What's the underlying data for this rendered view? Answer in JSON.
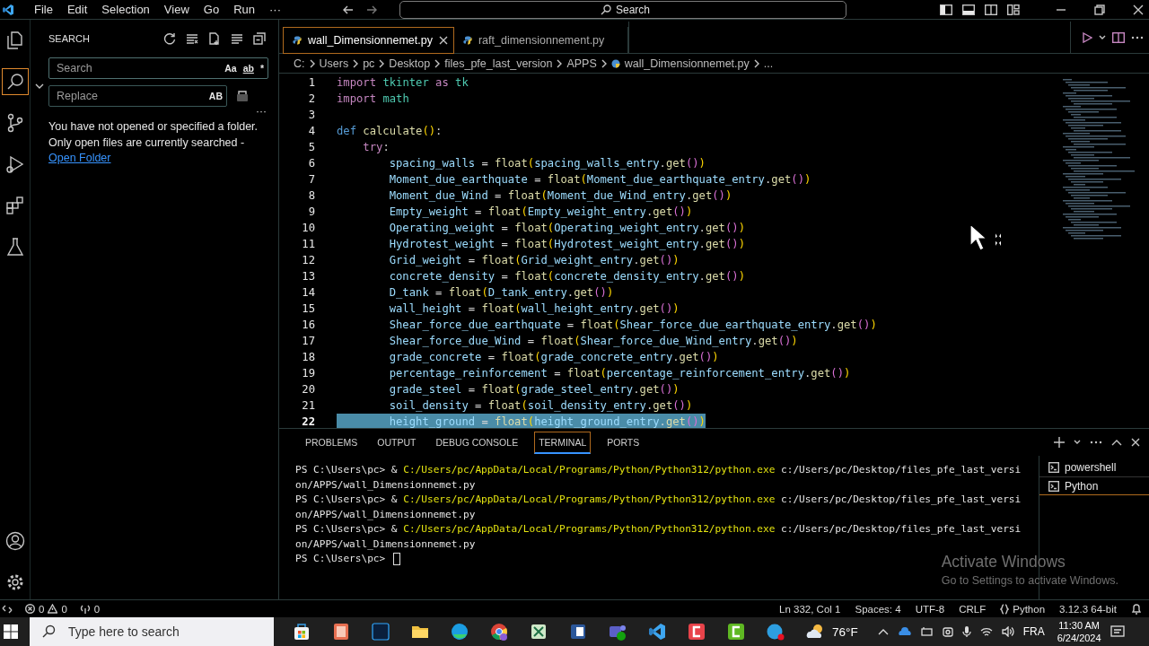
{
  "title_bar": {
    "menu": [
      "File",
      "Edit",
      "Selection",
      "View",
      "Go",
      "Run",
      "···"
    ],
    "command_center": {
      "placeholder": "Search"
    }
  },
  "sidebar": {
    "title": "SEARCH",
    "search": {
      "placeholder": "Search"
    },
    "search_options": [
      "Aa",
      "ab",
      "*"
    ],
    "replace": {
      "placeholder": "Replace"
    },
    "replace_option": "AB",
    "more": "···",
    "message": "You have not opened or specified a folder. Only open files are currently searched - ",
    "link": "Open Folder"
  },
  "tabs": [
    {
      "label": "wall_Dimensionnemet.py",
      "selected": true
    },
    {
      "label": "raft_dimensionnement.py",
      "selected": false
    }
  ],
  "breadcrumbs": [
    "C:",
    "Users",
    "pc",
    "Desktop",
    "files_pfe_last_version",
    "APPS",
    "wall_Dimensionnemet.py",
    "..."
  ],
  "code_lines": [
    {
      "number": "1",
      "selected": false,
      "tokens": [
        {
          "kind": "kw",
          "text": "import "
        },
        {
          "kind": "mod",
          "text": "tkinter "
        },
        {
          "kind": "kw",
          "text": "as "
        },
        {
          "kind": "mod",
          "text": "tk"
        }
      ]
    },
    {
      "number": "2",
      "selected": false,
      "tokens": [
        {
          "kind": "kw",
          "text": "import "
        },
        {
          "kind": "mod",
          "text": "math"
        }
      ]
    },
    {
      "number": "3",
      "selected": false
    },
    {
      "number": "4",
      "selected": false,
      "tokens": [
        {
          "kind": "def",
          "text": "def "
        },
        {
          "kind": "fn",
          "text": "calculate"
        },
        {
          "kind": "p1",
          "text": "()"
        },
        {
          "kind": "op",
          "text": ":"
        }
      ]
    },
    {
      "number": "5",
      "selected": false,
      "tokens": [
        {
          "kind": "kw",
          "text": "    try"
        },
        {
          "kind": "op",
          "text": ":"
        }
      ]
    },
    {
      "number": "6",
      "selected": false,
      "tokens": [
        {
          "kind": "var",
          "text": "        spacing_walls"
        },
        {
          "kind": "op",
          "text": " = "
        },
        {
          "kind": "fn",
          "text": "float"
        },
        {
          "kind": "p1",
          "text": "("
        },
        {
          "kind": "var",
          "text": "spacing_walls_entry"
        },
        {
          "kind": "op",
          "text": "."
        },
        {
          "kind": "fn",
          "text": "get"
        },
        {
          "kind": "p2",
          "text": "()"
        },
        {
          "kind": "p1",
          "text": ")"
        }
      ]
    },
    {
      "number": "7",
      "selected": false,
      "tokens": [
        {
          "kind": "var",
          "text": "        Moment_due_earthquate"
        },
        {
          "kind": "op",
          "text": " = "
        },
        {
          "kind": "fn",
          "text": "float"
        },
        {
          "kind": "p1",
          "text": "("
        },
        {
          "kind": "var",
          "text": "Moment_due_earthquate_entry"
        },
        {
          "kind": "op",
          "text": "."
        },
        {
          "kind": "fn",
          "text": "get"
        },
        {
          "kind": "p2",
          "text": "()"
        },
        {
          "kind": "p1",
          "text": ")"
        }
      ]
    },
    {
      "number": "8",
      "selected": false,
      "tokens": [
        {
          "kind": "var",
          "text": "        Moment_due_Wind"
        },
        {
          "kind": "op",
          "text": " = "
        },
        {
          "kind": "fn",
          "text": "float"
        },
        {
          "kind": "p1",
          "text": "("
        },
        {
          "kind": "var",
          "text": "Moment_due_Wind_entry"
        },
        {
          "kind": "op",
          "text": "."
        },
        {
          "kind": "fn",
          "text": "get"
        },
        {
          "kind": "p2",
          "text": "()"
        },
        {
          "kind": "p1",
          "text": ")"
        }
      ]
    },
    {
      "number": "9",
      "selected": false,
      "tokens": [
        {
          "kind": "var",
          "text": "        Empty_weight"
        },
        {
          "kind": "op",
          "text": " = "
        },
        {
          "kind": "fn",
          "text": "float"
        },
        {
          "kind": "p1",
          "text": "("
        },
        {
          "kind": "var",
          "text": "Empty_weight_entry"
        },
        {
          "kind": "op",
          "text": "."
        },
        {
          "kind": "fn",
          "text": "get"
        },
        {
          "kind": "p2",
          "text": "()"
        },
        {
          "kind": "p1",
          "text": ")"
        }
      ]
    },
    {
      "number": "10",
      "selected": false,
      "tokens": [
        {
          "kind": "var",
          "text": "        Operating_weight"
        },
        {
          "kind": "op",
          "text": " = "
        },
        {
          "kind": "fn",
          "text": "float"
        },
        {
          "kind": "p1",
          "text": "("
        },
        {
          "kind": "var",
          "text": "Operating_weight_entry"
        },
        {
          "kind": "op",
          "text": "."
        },
        {
          "kind": "fn",
          "text": "get"
        },
        {
          "kind": "p2",
          "text": "()"
        },
        {
          "kind": "p1",
          "text": ")"
        }
      ]
    },
    {
      "number": "11",
      "selected": false,
      "tokens": [
        {
          "kind": "var",
          "text": "        Hydrotest_weight"
        },
        {
          "kind": "op",
          "text": " = "
        },
        {
          "kind": "fn",
          "text": "float"
        },
        {
          "kind": "p1",
          "text": "("
        },
        {
          "kind": "var",
          "text": "Hydrotest_weight_entry"
        },
        {
          "kind": "op",
          "text": "."
        },
        {
          "kind": "fn",
          "text": "get"
        },
        {
          "kind": "p2",
          "text": "()"
        },
        {
          "kind": "p1",
          "text": ")"
        }
      ]
    },
    {
      "number": "12",
      "selected": false,
      "tokens": [
        {
          "kind": "var",
          "text": "        Grid_weight"
        },
        {
          "kind": "op",
          "text": " = "
        },
        {
          "kind": "fn",
          "text": "float"
        },
        {
          "kind": "p1",
          "text": "("
        },
        {
          "kind": "var",
          "text": "Grid_weight_entry"
        },
        {
          "kind": "op",
          "text": "."
        },
        {
          "kind": "fn",
          "text": "get"
        },
        {
          "kind": "p2",
          "text": "()"
        },
        {
          "kind": "p1",
          "text": ")"
        }
      ]
    },
    {
      "number": "13",
      "selected": false,
      "tokens": [
        {
          "kind": "var",
          "text": "        concrete_density"
        },
        {
          "kind": "op",
          "text": " = "
        },
        {
          "kind": "fn",
          "text": "float"
        },
        {
          "kind": "p1",
          "text": "("
        },
        {
          "kind": "var",
          "text": "concrete_density_entry"
        },
        {
          "kind": "op",
          "text": "."
        },
        {
          "kind": "fn",
          "text": "get"
        },
        {
          "kind": "p2",
          "text": "()"
        },
        {
          "kind": "p1",
          "text": ")"
        }
      ]
    },
    {
      "number": "14",
      "selected": false,
      "tokens": [
        {
          "kind": "var",
          "text": "        D_tank"
        },
        {
          "kind": "op",
          "text": " = "
        },
        {
          "kind": "fn",
          "text": "float"
        },
        {
          "kind": "p1",
          "text": "("
        },
        {
          "kind": "var",
          "text": "D_tank_entry"
        },
        {
          "kind": "op",
          "text": "."
        },
        {
          "kind": "fn",
          "text": "get"
        },
        {
          "kind": "p2",
          "text": "()"
        },
        {
          "kind": "p1",
          "text": ")"
        }
      ]
    },
    {
      "number": "15",
      "selected": false,
      "tokens": [
        {
          "kind": "var",
          "text": "        wall_height"
        },
        {
          "kind": "op",
          "text": " = "
        },
        {
          "kind": "fn",
          "text": "float"
        },
        {
          "kind": "p1",
          "text": "("
        },
        {
          "kind": "var",
          "text": "wall_height_entry"
        },
        {
          "kind": "op",
          "text": "."
        },
        {
          "kind": "fn",
          "text": "get"
        },
        {
          "kind": "p2",
          "text": "()"
        },
        {
          "kind": "p1",
          "text": ")"
        }
      ]
    },
    {
      "number": "16",
      "selected": false,
      "tokens": [
        {
          "kind": "var",
          "text": "        Shear_force_due_earthquate"
        },
        {
          "kind": "op",
          "text": " = "
        },
        {
          "kind": "fn",
          "text": "float"
        },
        {
          "kind": "p1",
          "text": "("
        },
        {
          "kind": "var",
          "text": "Shear_force_due_earthquate_entry"
        },
        {
          "kind": "op",
          "text": "."
        },
        {
          "kind": "fn",
          "text": "get"
        },
        {
          "kind": "p2",
          "text": "()"
        },
        {
          "kind": "p1",
          "text": ")"
        }
      ]
    },
    {
      "number": "17",
      "selected": false,
      "tokens": [
        {
          "kind": "var",
          "text": "        Shear_force_due_Wind"
        },
        {
          "kind": "op",
          "text": " = "
        },
        {
          "kind": "fn",
          "text": "float"
        },
        {
          "kind": "p1",
          "text": "("
        },
        {
          "kind": "var",
          "text": "Shear_force_due_Wind_entry"
        },
        {
          "kind": "op",
          "text": "."
        },
        {
          "kind": "fn",
          "text": "get"
        },
        {
          "kind": "p2",
          "text": "()"
        },
        {
          "kind": "p1",
          "text": ")"
        }
      ]
    },
    {
      "number": "18",
      "selected": false,
      "tokens": [
        {
          "kind": "var",
          "text": "        grade_concrete"
        },
        {
          "kind": "op",
          "text": " = "
        },
        {
          "kind": "fn",
          "text": "float"
        },
        {
          "kind": "p1",
          "text": "("
        },
        {
          "kind": "var",
          "text": "grade_concrete_entry"
        },
        {
          "kind": "op",
          "text": "."
        },
        {
          "kind": "fn",
          "text": "get"
        },
        {
          "kind": "p2",
          "text": "()"
        },
        {
          "kind": "p1",
          "text": ")"
        }
      ]
    },
    {
      "number": "19",
      "selected": false,
      "tokens": [
        {
          "kind": "var",
          "text": "        percentage_reinforcement"
        },
        {
          "kind": "op",
          "text": " = "
        },
        {
          "kind": "fn",
          "text": "float"
        },
        {
          "kind": "p1",
          "text": "("
        },
        {
          "kind": "var",
          "text": "percentage_reinforcement_entry"
        },
        {
          "kind": "op",
          "text": "."
        },
        {
          "kind": "fn",
          "text": "get"
        },
        {
          "kind": "p2",
          "text": "()"
        },
        {
          "kind": "p1",
          "text": ")"
        }
      ]
    },
    {
      "number": "20",
      "selected": false,
      "tokens": [
        {
          "kind": "var",
          "text": "        grade_steel"
        },
        {
          "kind": "op",
          "text": " = "
        },
        {
          "kind": "fn",
          "text": "float"
        },
        {
          "kind": "p1",
          "text": "("
        },
        {
          "kind": "var",
          "text": "grade_steel_entry"
        },
        {
          "kind": "op",
          "text": "."
        },
        {
          "kind": "fn",
          "text": "get"
        },
        {
          "kind": "p2",
          "text": "()"
        },
        {
          "kind": "p1",
          "text": ")"
        }
      ]
    },
    {
      "number": "21",
      "selected": false,
      "tokens": [
        {
          "kind": "var",
          "text": "        soil_density"
        },
        {
          "kind": "op",
          "text": " = "
        },
        {
          "kind": "fn",
          "text": "float"
        },
        {
          "kind": "p1",
          "text": "("
        },
        {
          "kind": "var",
          "text": "soil_density_entry"
        },
        {
          "kind": "op",
          "text": "."
        },
        {
          "kind": "fn",
          "text": "get"
        },
        {
          "kind": "p2",
          "text": "()"
        },
        {
          "kind": "p1",
          "text": ")"
        }
      ]
    },
    {
      "number": "22",
      "selected": true,
      "tokens": [
        {
          "kind": "var",
          "text": "        height_ground"
        },
        {
          "kind": "op",
          "text": " = "
        },
        {
          "kind": "fn",
          "text": "float"
        },
        {
          "kind": "p1",
          "text": "("
        },
        {
          "kind": "var",
          "text": "height_ground_entry"
        },
        {
          "kind": "op",
          "text": "."
        },
        {
          "kind": "fn",
          "text": "get"
        },
        {
          "kind": "p2",
          "text": "()"
        },
        {
          "kind": "p1",
          "text": ")"
        }
      ]
    }
  ],
  "panel": {
    "tabs": [
      {
        "label": "PROBLEMS",
        "selected": false
      },
      {
        "label": "OUTPUT",
        "selected": false
      },
      {
        "label": "DEBUG CONSOLE",
        "selected": false
      },
      {
        "label": "TERMINAL",
        "selected": true
      },
      {
        "label": "PORTS",
        "selected": false
      }
    ],
    "terminal_lines": [
      [
        {
          "kind": "plain",
          "text": "PS C:\\Users\\pc> & "
        },
        {
          "kind": "path",
          "text": "C:/Users/pc/AppData/Local/Programs/Python/Python312/python.exe"
        },
        {
          "kind": "plain",
          "text": " c:/Users/pc/Desktop/files_pfe_last_versi"
        }
      ],
      [
        {
          "kind": "plain",
          "text": "on/APPS/wall_Dimensionnemet.py"
        }
      ],
      [
        {
          "kind": "plain",
          "text": "PS C:\\Users\\pc> & "
        },
        {
          "kind": "path",
          "text": "C:/Users/pc/AppData/Local/Programs/Python/Python312/python.exe"
        },
        {
          "kind": "plain",
          "text": " c:/Users/pc/Desktop/files_pfe_last_versi"
        }
      ],
      [
        {
          "kind": "plain",
          "text": "on/APPS/wall_Dimensionnemet.py"
        }
      ],
      [
        {
          "kind": "plain",
          "text": "PS C:\\Users\\pc> & "
        },
        {
          "kind": "path",
          "text": "C:/Users/pc/AppData/Local/Programs/Python/Python312/python.exe"
        },
        {
          "kind": "plain",
          "text": " c:/Users/pc/Desktop/files_pfe_last_versi"
        }
      ],
      [
        {
          "kind": "plain",
          "text": "on/APPS/wall_Dimensionnemet.py"
        }
      ],
      [
        {
          "kind": "plain",
          "text": "PS C:\\Users\\pc> "
        }
      ]
    ],
    "terminals": [
      {
        "label": "powershell",
        "selected": false
      },
      {
        "label": "Python",
        "selected": true
      }
    ],
    "activation_notice": {
      "title": "Activate Windows",
      "subtitle": "Go to Settings to activate Windows."
    }
  },
  "status_bar": {
    "errors": "0",
    "warnings": "0",
    "ports": "0",
    "right": [
      {
        "kind": "text",
        "text": "Ln 332, Col 1"
      },
      {
        "kind": "text",
        "text": "Spaces: 4"
      },
      {
        "kind": "text",
        "text": "UTF-8"
      },
      {
        "kind": "text",
        "text": "CRLF"
      },
      {
        "kind": "language",
        "text": "Python"
      },
      {
        "kind": "text",
        "text": "3.12.3 64-bit"
      }
    ]
  },
  "taskbar": {
    "search": {
      "placeholder": "Type here to search"
    },
    "temperature": "76°F",
    "language": "FRA",
    "time": "11:30 AM",
    "date": "6/24/2024"
  }
}
